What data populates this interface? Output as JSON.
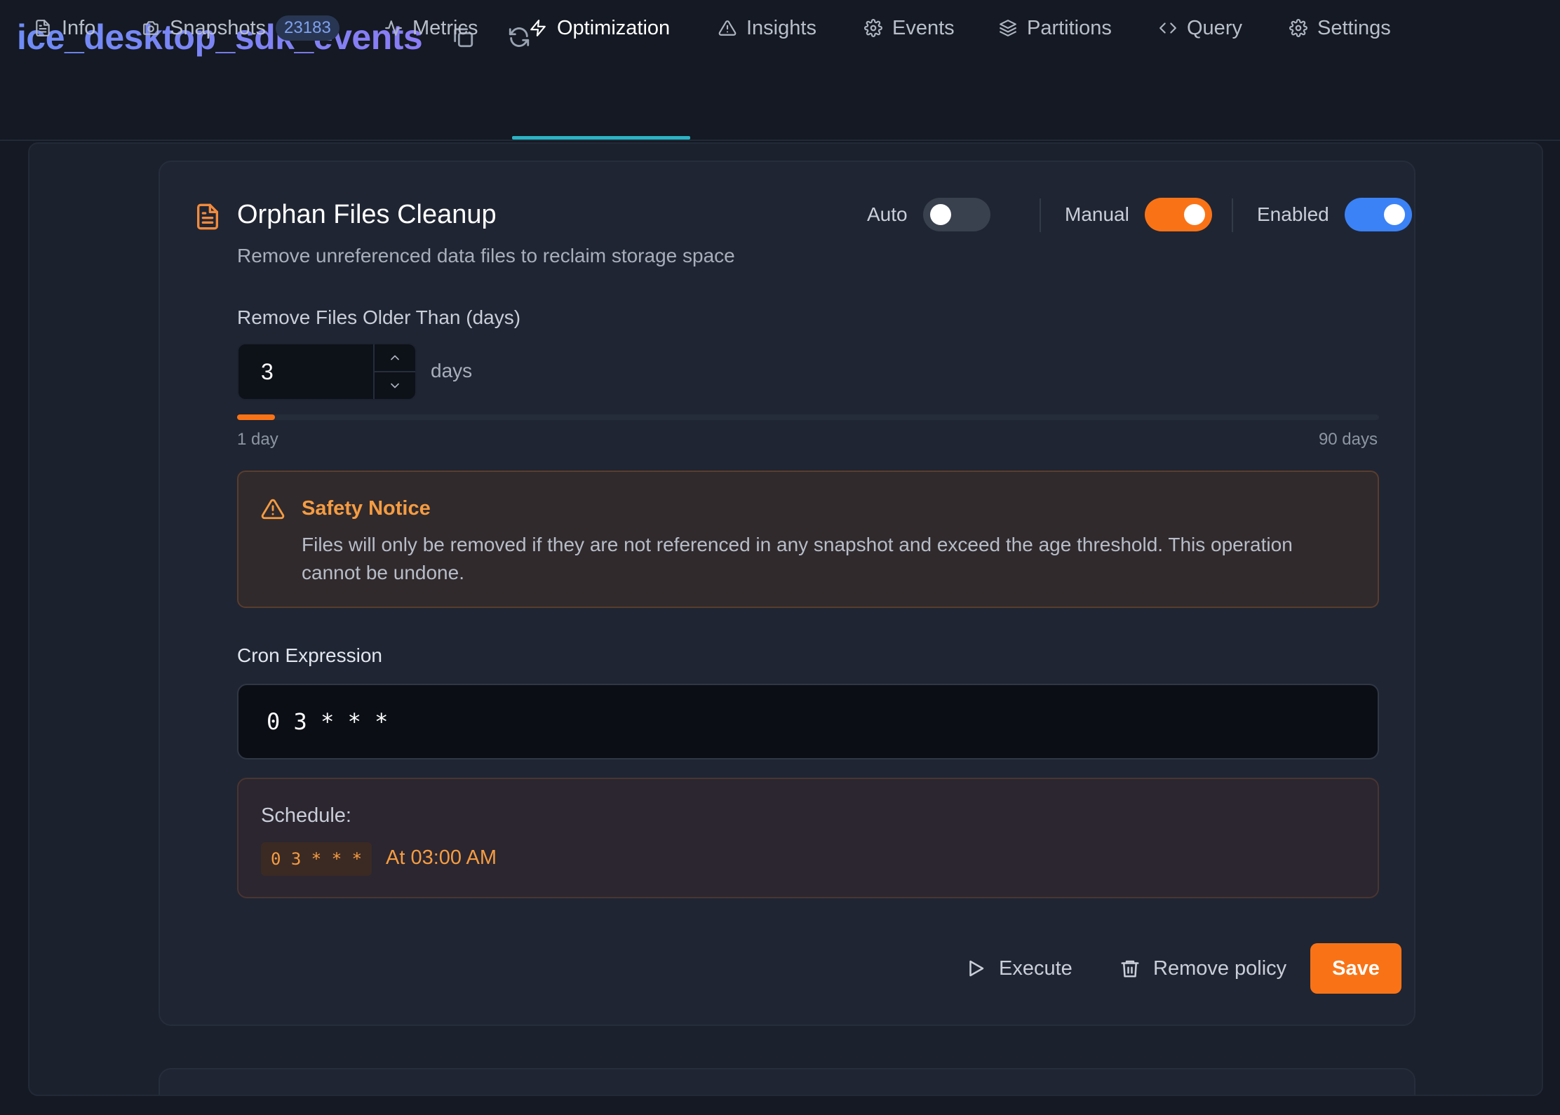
{
  "header": {
    "title": "ice_desktop_sdk_events",
    "actions": [
      {
        "icon": "copy-icon"
      },
      {
        "icon": "refresh-icon"
      }
    ]
  },
  "tabs": [
    {
      "id": "info",
      "label": "Info",
      "icon": "file-icon"
    },
    {
      "id": "snapshots",
      "label": "Snapshots",
      "icon": "camera-icon",
      "badge": "23183"
    },
    {
      "id": "metrics",
      "label": "Metrics",
      "icon": "activity-icon"
    },
    {
      "id": "optimization",
      "label": "Optimization",
      "icon": "lightning-icon",
      "active": true
    },
    {
      "id": "insights",
      "label": "Insights",
      "icon": "warning-icon"
    },
    {
      "id": "events",
      "label": "Events",
      "icon": "gear-icon"
    },
    {
      "id": "partitions",
      "label": "Partitions",
      "icon": "layers-icon"
    },
    {
      "id": "query",
      "label": "Query",
      "icon": "code-icon"
    },
    {
      "id": "settings",
      "label": "Settings",
      "icon": "gear-icon"
    }
  ],
  "policy": {
    "icon": "document-icon",
    "title": "Orphan Files Cleanup",
    "description": "Remove unreferenced data files to reclaim storage space",
    "toggles": {
      "auto": {
        "label": "Auto",
        "on": false
      },
      "manual": {
        "label": "Manual",
        "on": true
      },
      "enabled": {
        "label": "Enabled",
        "on": true
      }
    },
    "older_than": {
      "label": "Remove Files Older Than (days)",
      "value": "3",
      "unit": "days",
      "min_label": "1 day",
      "max_label": "90 days",
      "min": 1,
      "max": 90
    },
    "notice": {
      "title": "Safety Notice",
      "text": "Files will only be removed if they are not referenced in any snapshot and exceed the age threshold. This operation cannot be undone."
    },
    "cron": {
      "label": "Cron Expression",
      "value": "0 3 * * *"
    },
    "schedule": {
      "label": "Schedule:",
      "code": "0 3 * * *",
      "text": "At 03:00 AM"
    },
    "actions": {
      "execute": "Execute",
      "remove": "Remove policy",
      "save": "Save"
    }
  },
  "colors": {
    "accent_orange": "#f97316",
    "accent_blue": "#3b82f6",
    "tab_underline": "#2bb3c4",
    "title_gradient_start": "#6f8cf6",
    "title_gradient_end": "#8a7cf4"
  }
}
